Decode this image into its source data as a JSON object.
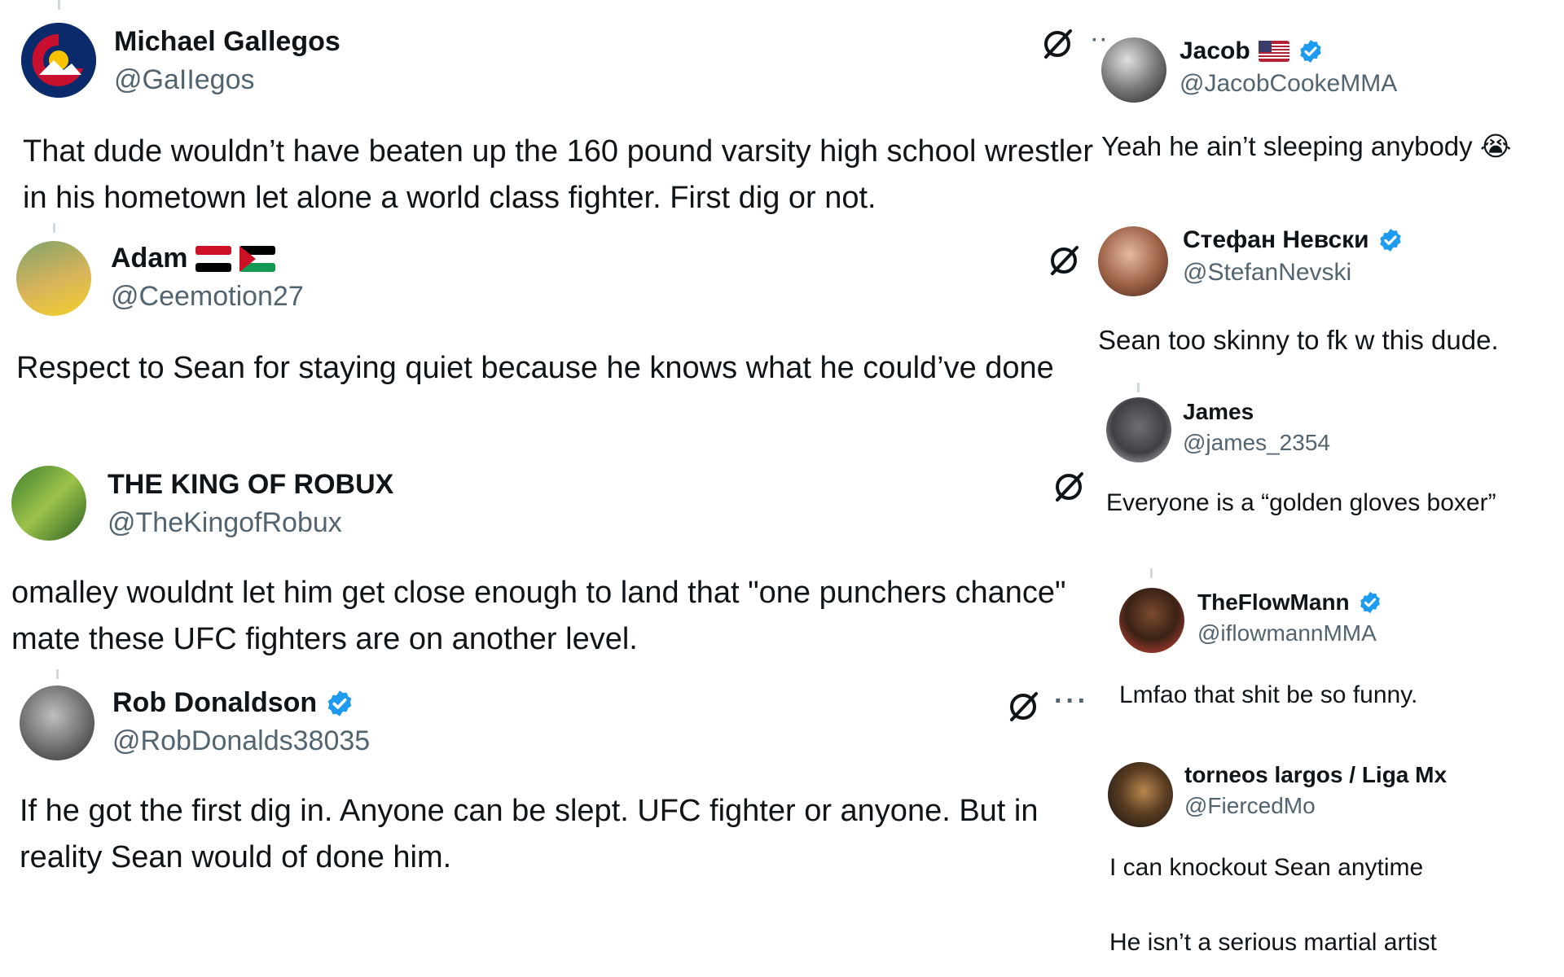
{
  "tweets_left": [
    {
      "name": "Michael Gallegos",
      "handle": "@GaIIegos",
      "text": "That dude wouldn’t have beaten up the 160 pound varsity high school wrestler in his hometown let alone a world class fighter. First dig or not.",
      "avatar_icon": "colorado-logo-avatar",
      "has_more_menu": true
    },
    {
      "name": "Adam",
      "handle": "@Ceemotion27",
      "text": "Respect to Sean for staying quiet because he knows what he could’ve done",
      "avatar_icon": "photo-avatar",
      "flags": [
        "egypt-flag",
        "palestine-flag"
      ]
    },
    {
      "name": "THE KING OF ROBUX",
      "handle": "@TheKingofRobux",
      "text": "omalley wouldnt let him get close enough to land that \"one punchers chance\" mate these UFC fighters are on another level.",
      "avatar_icon": "photo-avatar"
    },
    {
      "name": "Rob Donaldson",
      "handle": "@RobDonalds38035",
      "text": "If he got the first dig in. Anyone can be slept.  UFC fighter or anyone.  But in reality Sean would of done him.",
      "avatar_icon": "photo-avatar",
      "verified": true,
      "has_more_menu": true
    }
  ],
  "tweets_right": [
    {
      "name": "Jacob",
      "handle": "@JacobCookeMMA",
      "text": "Yeah he ain’t sleeping anybody 😭",
      "verified": true,
      "flags": [
        "usa-flag"
      ]
    },
    {
      "name": "Стефан Невски",
      "handle": "@StefanNevski",
      "text": "Sean too skinny to fk w this dude.",
      "verified": true
    },
    {
      "name": "James",
      "handle": "@james_2354",
      "text": "Everyone is a “golden gloves boxer”"
    },
    {
      "name": "TheFlowMann",
      "handle": "@iflowmannMMA",
      "text": "Lmfao that shit be so funny.",
      "verified": true
    },
    {
      "name": "torneos largos / Liga Mx",
      "handle": "@FiercedMo",
      "text_lines": [
        "I can knockout Sean anytime",
        "He isn’t a serious martial artist"
      ]
    }
  ],
  "icons": {
    "grok": "grok-icon",
    "more": "more-options-icon",
    "verified": "verified-badge-icon"
  },
  "colors": {
    "verified_blue": "#1d9bf0",
    "handle_gray": "#536471",
    "text": "#0f1419"
  }
}
